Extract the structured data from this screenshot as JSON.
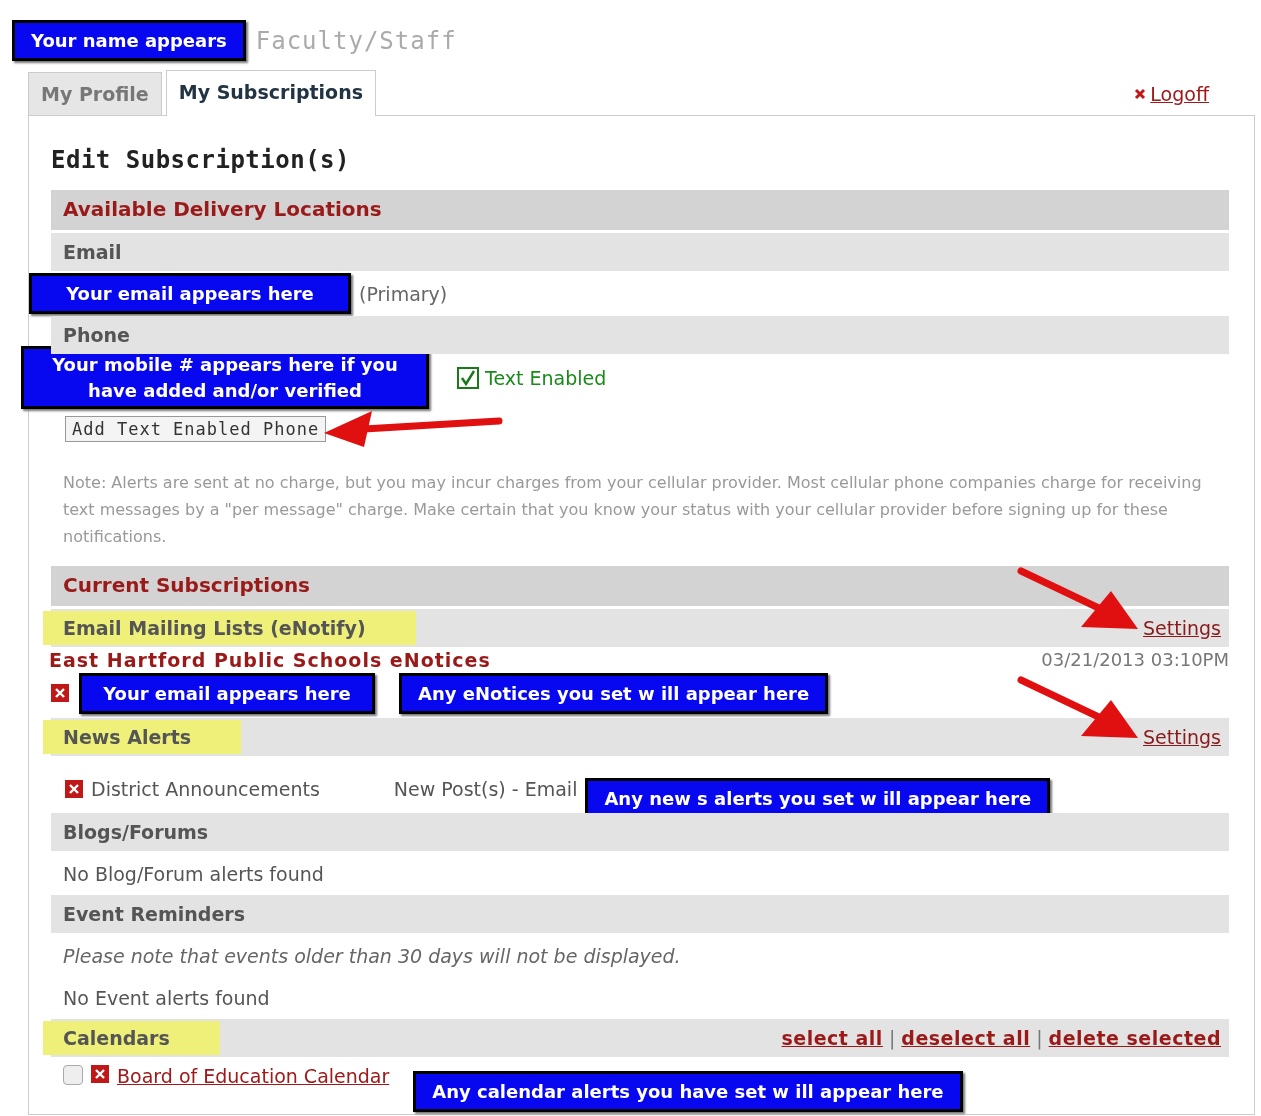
{
  "header": {
    "name_note": "Your name appears",
    "role": "Faculty/Staff"
  },
  "tabs": [
    {
      "label": "My Profile",
      "selected": false
    },
    {
      "label": "My Subscriptions",
      "selected": true
    }
  ],
  "logoff": "Logoff",
  "title": "Edit Subscription(s)",
  "delivery": {
    "heading": "Available Delivery Locations",
    "email": {
      "label": "Email",
      "note": "Your email appears here",
      "tag": "(Primary)"
    },
    "phone": {
      "label": "Phone",
      "note": "Your mobile # appears here if you have added and/or verified",
      "text_enabled": {
        "checked": true,
        "label": "Text Enabled"
      },
      "add_button": "Add Text Enabled Phone",
      "pointer": true
    },
    "note": "Note: Alerts are sent at no charge, but you may incur charges from your cellular provider. Most cellular phone companies charge for receiving text messages by a \"per message\" charge. Make certain that you know your status with your cellular provider before signing up for these notifications."
  },
  "subscriptions": {
    "heading": "Current Subscriptions",
    "separator": "|",
    "groups": [
      {
        "title": "Email Mailing Lists (eNotify)",
        "highlighted": true,
        "settings": "Settings",
        "pointer": true,
        "rows": [
          {
            "kind": "list",
            "name": "East Hartford Public Schools eNotices",
            "date": "03/21/2013 03:10PM"
          },
          {
            "kind": "subscriber",
            "email_note": "Your email appears here",
            "notices_note": "Any eNotices you set w ill appear here"
          }
        ]
      },
      {
        "title": "News Alerts",
        "highlighted": true,
        "settings": "Settings",
        "pointer": true,
        "rows": [
          {
            "kind": "alert",
            "name": "District Announcements",
            "type": "New Post(s) - Email",
            "note": "Any new s alerts you set w ill appear here"
          }
        ]
      },
      {
        "title": "Blogs/Forums",
        "highlighted": false,
        "rows": [
          {
            "kind": "empty",
            "text": "No Blog/Forum alerts found"
          }
        ]
      },
      {
        "title": "Event Reminders",
        "highlighted": false,
        "rows": [
          {
            "kind": "notice",
            "text": "Please note that events older than 30 days will not be displayed."
          },
          {
            "kind": "empty",
            "text": "No Event alerts found"
          }
        ]
      },
      {
        "title": "Calendars",
        "highlighted": true,
        "actions": [
          "select all",
          "deselect all",
          "delete selected"
        ],
        "rows": [
          {
            "kind": "calendar",
            "checked": false,
            "name": "Board of Education Calendar",
            "note": "Any calendar alerts you have set w ill appear here"
          }
        ]
      }
    ]
  }
}
